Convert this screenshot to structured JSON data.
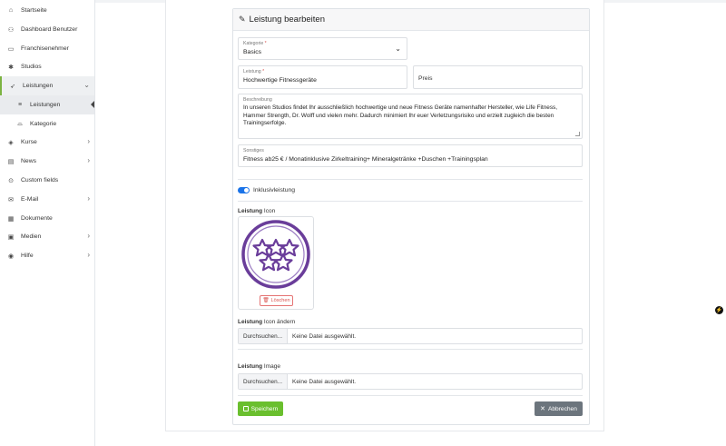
{
  "sidebar": {
    "items": [
      {
        "label": "Startseite",
        "icon": "home-icon",
        "glyph": "⌂"
      },
      {
        "label": "Dashboard Benutzer",
        "icon": "user-icon",
        "glyph": "👤"
      },
      {
        "label": "Franchisenehmer",
        "icon": "building-icon",
        "glyph": "▭"
      },
      {
        "label": "Studios",
        "icon": "gear-icon",
        "glyph": "✱"
      },
      {
        "label": "Leistungen",
        "icon": "rocket-icon",
        "glyph": "➶"
      },
      {
        "label": "Leistungen",
        "icon": "list-icon",
        "glyph": "≡"
      },
      {
        "label": "Kategorie",
        "icon": "folder-icon",
        "glyph": "⌂"
      },
      {
        "label": "Kurse",
        "icon": "stack-icon",
        "glyph": "◈"
      },
      {
        "label": "News",
        "icon": "document-icon",
        "glyph": "▤"
      },
      {
        "label": "Custom fields",
        "icon": "tag-icon",
        "glyph": "⊙"
      },
      {
        "label": "E-Mail",
        "icon": "mail-icon",
        "glyph": "✉"
      },
      {
        "label": "Dokumente",
        "icon": "file-icon",
        "glyph": "▦"
      },
      {
        "label": "Medien",
        "icon": "media-icon",
        "glyph": "▣"
      },
      {
        "label": "Hilfe",
        "icon": "help-icon",
        "glyph": "◉"
      }
    ]
  },
  "card": {
    "title": "Leistung bearbeiten"
  },
  "form": {
    "kategorie_label": "Kategorie",
    "kategorie_value": "Basics",
    "leistung_label": "Leistung",
    "leistung_value": "Hochwertige Fitnessgeräte",
    "preis_placeholder": "Preis",
    "beschreibung_label": "Beschreibung",
    "beschreibung_value": "In unseren Studios findet Ihr ausschließlich hochwertige und neue Fitness Geräte namenhafter Hersteller, wie Life Fitness, Hammer Strength, Dr. Wolff und vielen mehr. Dadurch minimiert Ihr euer Verletzungsrisiko und erzielt zugleich die besten Trainingserfolge.",
    "sonstiges_label": "Sonstiges",
    "sonstiges_value": "Fitness ab25 € / Monatinklusive Zirkeltraining+ Mineralgetränke +Duschen +Trainingsplan",
    "required_mark": "*",
    "toggle_label": "Inklusivleistung",
    "toggle_on": true,
    "icon_section_bold": "Leistung",
    "icon_section_rest": " Icon",
    "delete_label": "Löschen",
    "icon_change_bold": "Leistung",
    "icon_change_rest": " Icon ändern",
    "browse_label": "Durchsuchen...",
    "no_file": "Keine Datei ausgewählt.",
    "image_bold": "Leistung",
    "image_rest": " Image",
    "save_label": "Speichern",
    "cancel_label": "Abbrechen"
  },
  "colors": {
    "accent_green": "#6abf2e",
    "toggle_blue": "#1a73e8",
    "icon_purple": "#6a3d9a",
    "delete_red": "#d9534f"
  }
}
